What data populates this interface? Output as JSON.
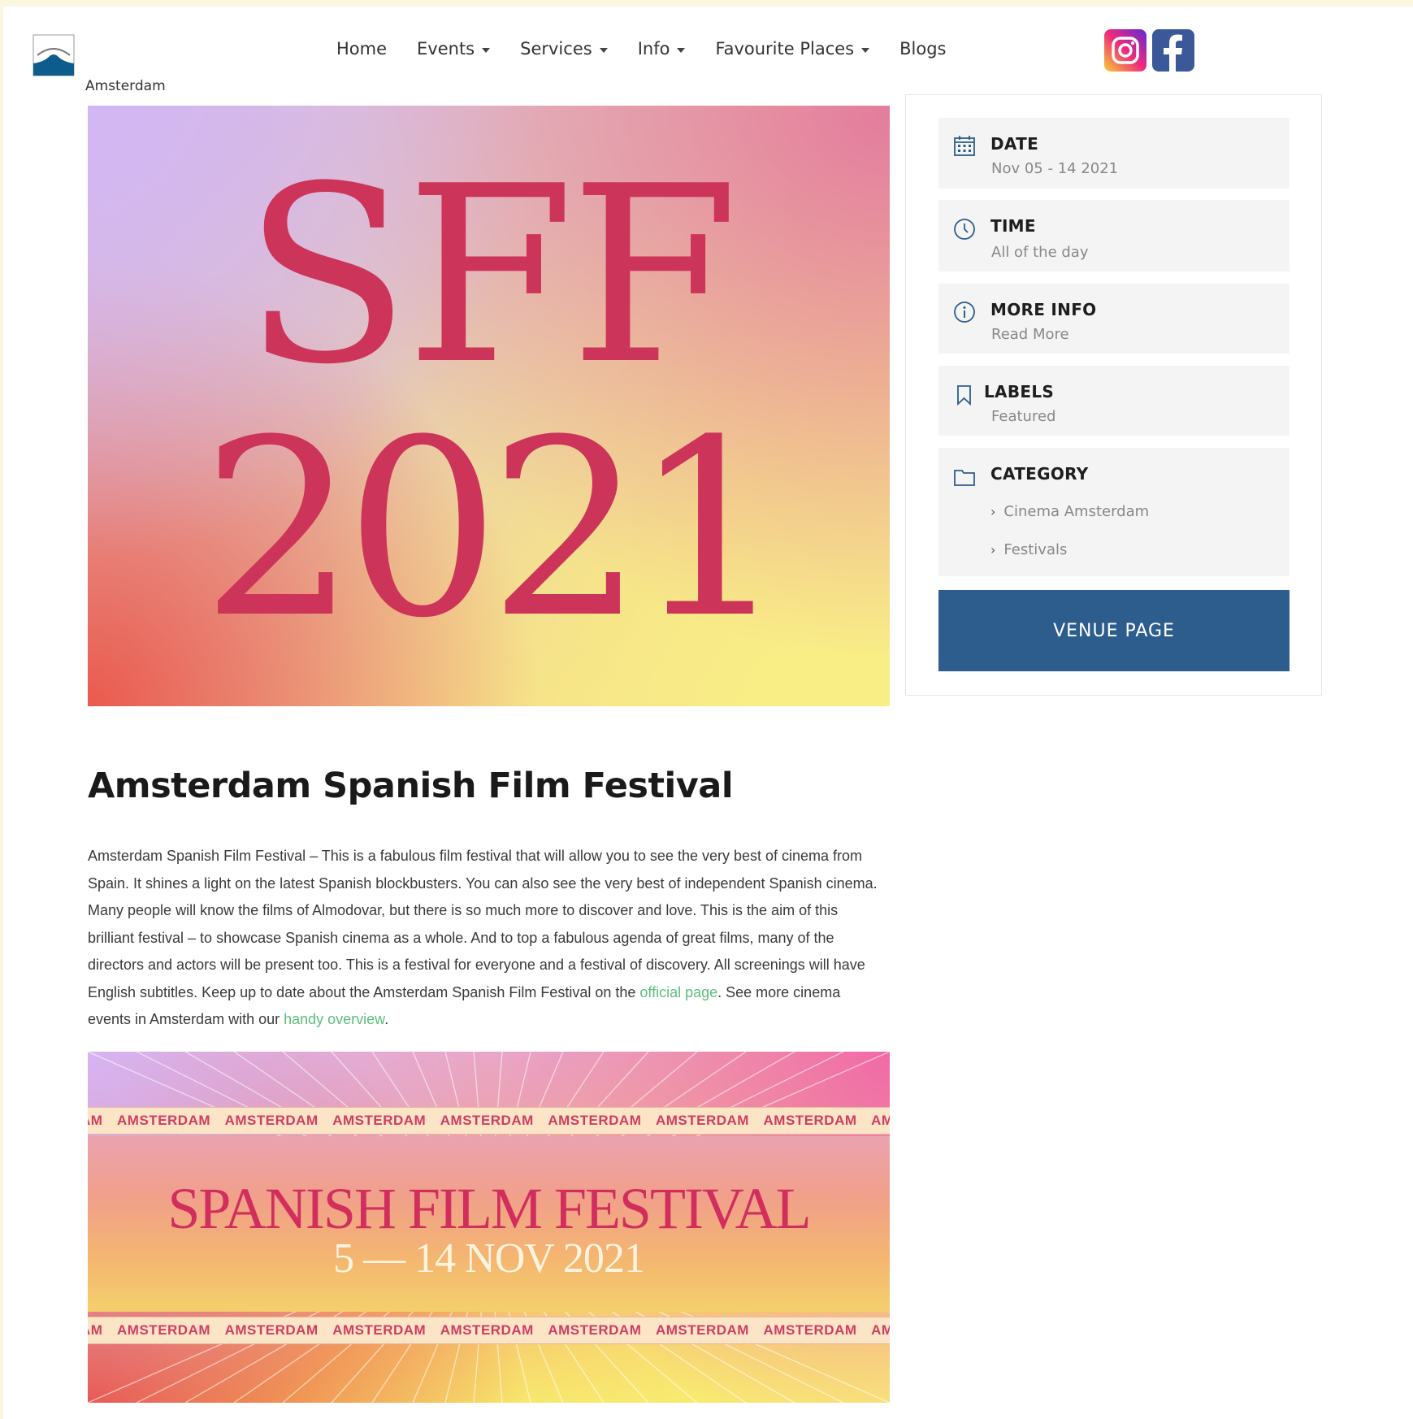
{
  "header": {
    "site_name": "Amsterdam",
    "nav": [
      {
        "label": "Home",
        "dropdown": false
      },
      {
        "label": "Events",
        "dropdown": true
      },
      {
        "label": "Services",
        "dropdown": true
      },
      {
        "label": "Info",
        "dropdown": true
      },
      {
        "label": "Favourite Places",
        "dropdown": true
      },
      {
        "label": "Blogs",
        "dropdown": false
      }
    ],
    "social": [
      "instagram-icon",
      "facebook-icon"
    ]
  },
  "hero": {
    "line1": "SFF",
    "line2": "2021"
  },
  "sidebar": {
    "date": {
      "title": "DATE",
      "value": "Nov 05 - 14 2021",
      "icon": "calendar-icon"
    },
    "time": {
      "title": "TIME",
      "value": "All of the day",
      "icon": "clock-icon"
    },
    "more_info": {
      "title": "MORE INFO",
      "value": "Read More",
      "icon": "info-icon"
    },
    "labels": {
      "title": "LABELS",
      "value": "Featured",
      "icon": "bookmark-icon"
    },
    "category": {
      "title": "CATEGORY",
      "icon": "folder-icon",
      "items": [
        "Cinema Amsterdam",
        "Festivals"
      ]
    },
    "venue_button": "VENUE PAGE"
  },
  "article": {
    "title": "Amsterdam Spanish Film Festival",
    "body_before_link1": "Amsterdam Spanish Film Festival – This is a fabulous film festival that will allow you to see the very best of cinema from Spain. It shines a light on the latest Spanish blockbusters. You can also see the very best of independent Spanish cinema. Many people will know the films of Almodovar, but there is so much more to discover and love. This is the aim of this brilliant festival – to showcase Spanish cinema as a whole. And to top a fabulous agenda of great films, many of the directors and actors will be present too. This is a festival for everyone and a festival of discovery. All screenings will have English subtitles. Keep up to date about the Amsterdam Spanish Film Festival on the ",
    "link1": "official page",
    "body_between_links": ". See more cinema events in Amsterdam with our ",
    "link2": "handy overview",
    "body_after_link2": "."
  },
  "poster": {
    "band_text": "AM AMSTERDAM AMSTERDAM AMSTERDAM AMSTERDAM AMSTERDAM AMSTERDAM AMSTERDAM AMSTERDAM AM",
    "title": "SPANISH FILM FESTIVAL",
    "dates": "5 — 14 NOV 2021"
  },
  "colors": {
    "accent_blue": "#2d5d8c",
    "link_green": "#5bbf7a",
    "festival_red": "#cd3459"
  }
}
